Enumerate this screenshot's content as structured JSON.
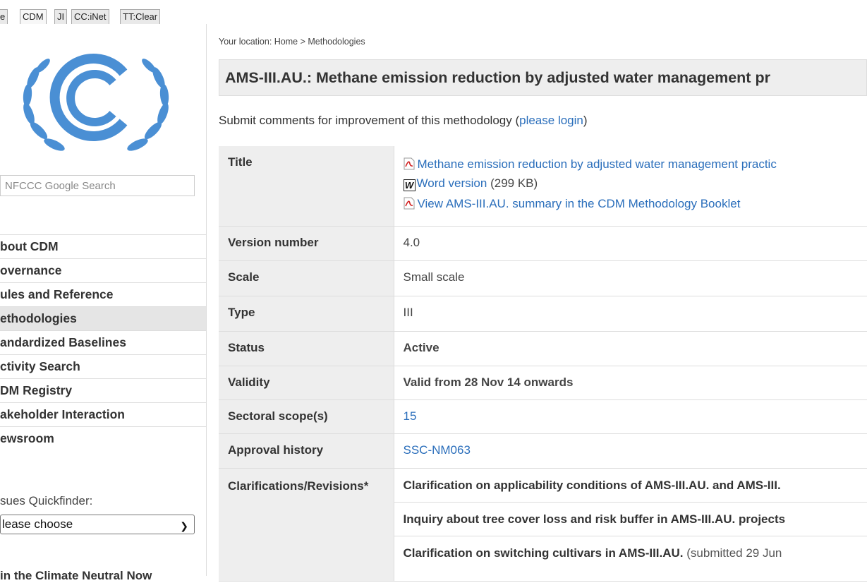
{
  "tabs": [
    "e",
    "CDM",
    "JI",
    "CC:iNet",
    "TT:Clear"
  ],
  "sidebar": {
    "search_placeholder": "NFCCC Google Search",
    "nav": [
      "bout CDM",
      "overnance",
      "ules and Reference",
      "ethodologies",
      "andardized Baselines",
      "ctivity Search",
      "DM Registry",
      "akeholder Interaction",
      "ewsroom"
    ],
    "quickfinder_label": "sues Quickfinder:",
    "quickfinder_selected": "lease choose",
    "join_text": "in the Climate Neutral Now"
  },
  "breadcrumb": "Your location: Home > Methodologies",
  "page_title": "AMS-III.AU.: Methane emission reduction by adjusted water management pr",
  "submit": {
    "text": "Submit comments for improvement of this methodology (",
    "link": "please login",
    "close": ")"
  },
  "table": {
    "title_label": "Title",
    "title_pdf_link": "Methane emission reduction by adjusted water management practic",
    "word_link": "Word version",
    "word_size": "(299 KB)",
    "booklet_link": "View AMS-III.AU. summary in the CDM Methodology Booklet",
    "version_label": "Version number",
    "version_value": "4.0",
    "scale_label": "Scale",
    "scale_value": "Small scale",
    "type_label": "Type",
    "type_value": "III",
    "status_label": "Status",
    "status_value": "Active",
    "validity_label": "Validity",
    "validity_value": "Valid from 28 Nov 14 onwards",
    "sectoral_label": "Sectoral scope(s)",
    "sectoral_value": "15",
    "approval_label": "Approval history",
    "approval_value": "SSC-NM063",
    "clarif_label": "Clarifications/Revisions*",
    "clarifications": [
      {
        "bold": "Clarification on applicability conditions of AMS-III.AU. and AMS-III.",
        "rest": ""
      },
      {
        "bold": "Inquiry about tree cover loss and risk buffer in AMS-III.AU. projects",
        "rest": ""
      },
      {
        "bold": "Clarification on switching cultivars in AMS-III.AU.",
        "rest": " (submitted 29 Jun"
      }
    ]
  },
  "colors": {
    "link": "#2a6ebb",
    "label_bg": "#eeeeee",
    "logo_blue": "#4a8fd4"
  }
}
